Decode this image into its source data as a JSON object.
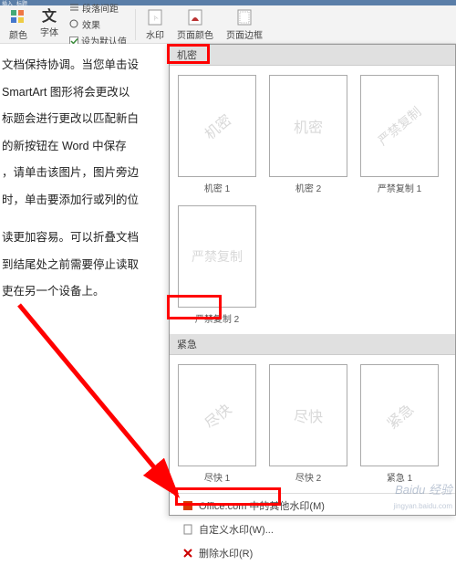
{
  "quickbar": {
    "t1": "插入",
    "t2": "标题"
  },
  "ribbon": {
    "colors_label": "颜色",
    "fonts_label": "字体",
    "para_spacing": "段落间距",
    "effects": "效果",
    "set_default": "设为默认值",
    "watermark": "水印",
    "page_color": "页面颜色",
    "page_borders": "页面边框"
  },
  "document": {
    "p1": "文档保持协调。当您单击设",
    "p2": " SmartArt  图形将会更改以",
    "p3": "标题会进行更改以匹配新白",
    "p4": "的新按钮在  Word  中保存",
    "p5": "，请单击该图片，图片旁边",
    "p6": "时，单击要添加行或列的位",
    "p7": "读更加容易。可以折叠文档",
    "p8": "到结尾处之前需要停止读取",
    "p9": "吏在另一个设备上。"
  },
  "wm": {
    "section_confidential": "机密",
    "section_urgent": "紧急",
    "items_confidential": [
      {
        "text": "机密",
        "label": "机密 1"
      },
      {
        "text": "机密",
        "label": "机密 2"
      },
      {
        "text": "严禁复制",
        "label": "严禁复制 1"
      },
      {
        "text": "严禁复制",
        "label": "严禁复制 2"
      }
    ],
    "items_urgent": [
      {
        "text": "尽快",
        "label": "尽快 1"
      },
      {
        "text": "尽快",
        "label": "尽快 2"
      },
      {
        "text": "紧急",
        "label": "紧急 1"
      }
    ],
    "footer": {
      "office_more": "Office.com 中的其他水印(M)",
      "custom": "自定义水印(W)...",
      "remove": "删除水印(R)"
    }
  },
  "baidu": {
    "brand": "Baidu 经验",
    "url": "jingyan.baidu.com"
  }
}
